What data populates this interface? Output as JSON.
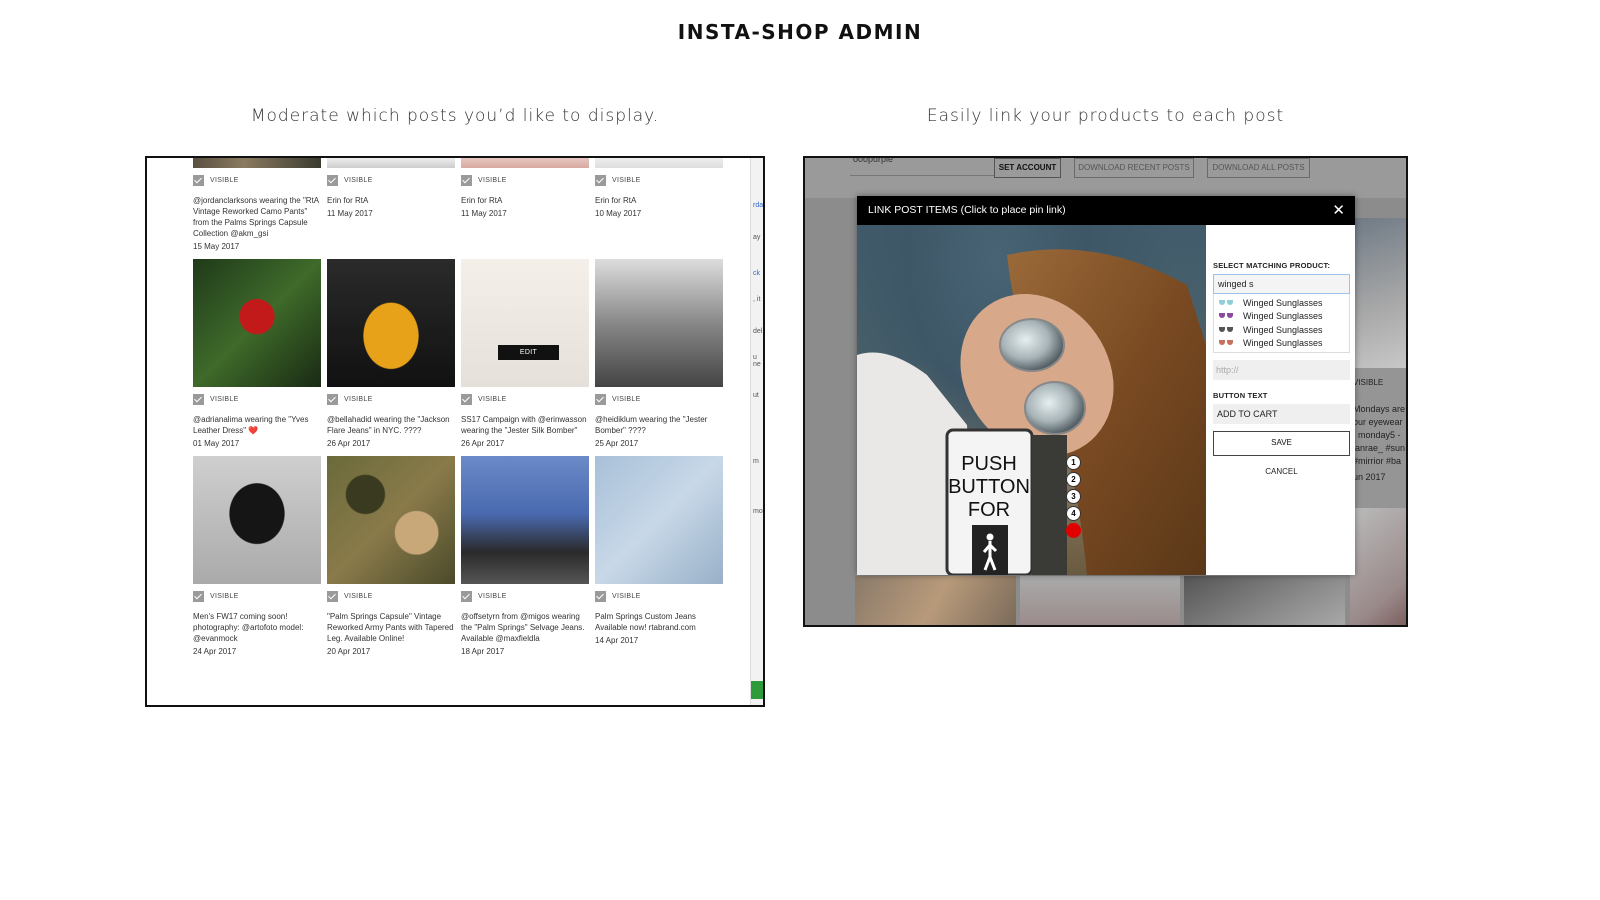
{
  "page": {
    "title": "INSTA-SHOP ADMIN",
    "left_caption": "Moderate which posts you’d like to display.",
    "right_caption": "Easily link your products to each post"
  },
  "moderation": {
    "visible_label": "VISIBLE",
    "edit_label": "EDIT",
    "rows": [
      [
        {
          "text": "@jordanclarksons wearing the \"RtA Vintage Reworked Camo Pants\" from the Palms Springs Capsule Collection @akm_gsi",
          "date": "15 May 2017",
          "visible": true
        },
        {
          "text": "Erin for RtA",
          "date": "11 May 2017",
          "visible": true
        },
        {
          "text": "Erin for RtA",
          "date": "11 May 2017",
          "visible": true
        },
        {
          "text": "Erin for RtA",
          "date": "10 May 2017",
          "visible": true
        }
      ],
      [
        {
          "text": "@adrianalima wearing the \"Yves Leather Dress\" ❤️",
          "date": "01 May 2017",
          "visible": true
        },
        {
          "text": "@bellahadid wearing the \"Jackson Flare Jeans\" in NYC. ????",
          "date": "26 Apr 2017",
          "visible": true
        },
        {
          "text": "SS17 Campaign with @erinwasson wearing the \"Jester Silk Bomber\"",
          "date": "26 Apr 2017",
          "visible": true
        },
        {
          "text": "@heidiklum wearing the \"Jester Bomber\" ????",
          "date": "25 Apr 2017",
          "visible": true
        }
      ],
      [
        {
          "text": "Men's FW17 coming soon! photography: @artofoto model: @evanmock",
          "date": "24 Apr 2017",
          "visible": true
        },
        {
          "text": "\"Palm Springs Capsule\" Vintage Reworked Army Pants with Tapered Leg. Available Online!",
          "date": "20 Apr 2017",
          "visible": true
        },
        {
          "text": "@offsetyrn from @migos wearing the \"Palm Springs\" Selvage Jeans. Available @maxfieldla",
          "date": "18 Apr 2017",
          "visible": true
        },
        {
          "text": "Palm Springs Custom Jeans Available now! rtabrand.com",
          "date": "14 Apr 2017",
          "visible": true
        }
      ]
    ]
  },
  "link_panel": {
    "background": {
      "account_text": "ooopurple",
      "set_account": "SET ACCOUNT",
      "download_recent": "DOWNLOAD RECENT POSTS",
      "download_all": "DOWNLOAD ALL POSTS",
      "side_visible": "VISIBLE",
      "side_text": [
        "Mondays are",
        "our eyewear",
        ": monday5 -",
        "ianrae_ #sun",
        "#mirrior #ba",
        "un 2017"
      ]
    },
    "modal": {
      "title": "LINK POST ITEMS (Click to place pin link)",
      "close_icon": "✕",
      "select_label": "SELECT MATCHING PRODUCT:",
      "search_value": "winged s",
      "results": [
        {
          "label": "Winged Sunglasses",
          "color": "#8fd0d6"
        },
        {
          "label": "Winged Sunglasses",
          "color": "#8a4aa0"
        },
        {
          "label": "Winged Sunglasses",
          "color": "#555555"
        },
        {
          "label": "Winged Sunglasses",
          "color": "#c8705e"
        }
      ],
      "url_placeholder": "http://",
      "button_text_label": "BUTTON TEXT",
      "button_text_value": "ADD TO CART",
      "save_label": "SAVE",
      "cancel_label": "CANCEL",
      "pins": [
        "1",
        "2",
        "3",
        "4",
        ""
      ],
      "image_sign_text": [
        "PUSH",
        "BUTTON",
        "FOR"
      ]
    }
  }
}
